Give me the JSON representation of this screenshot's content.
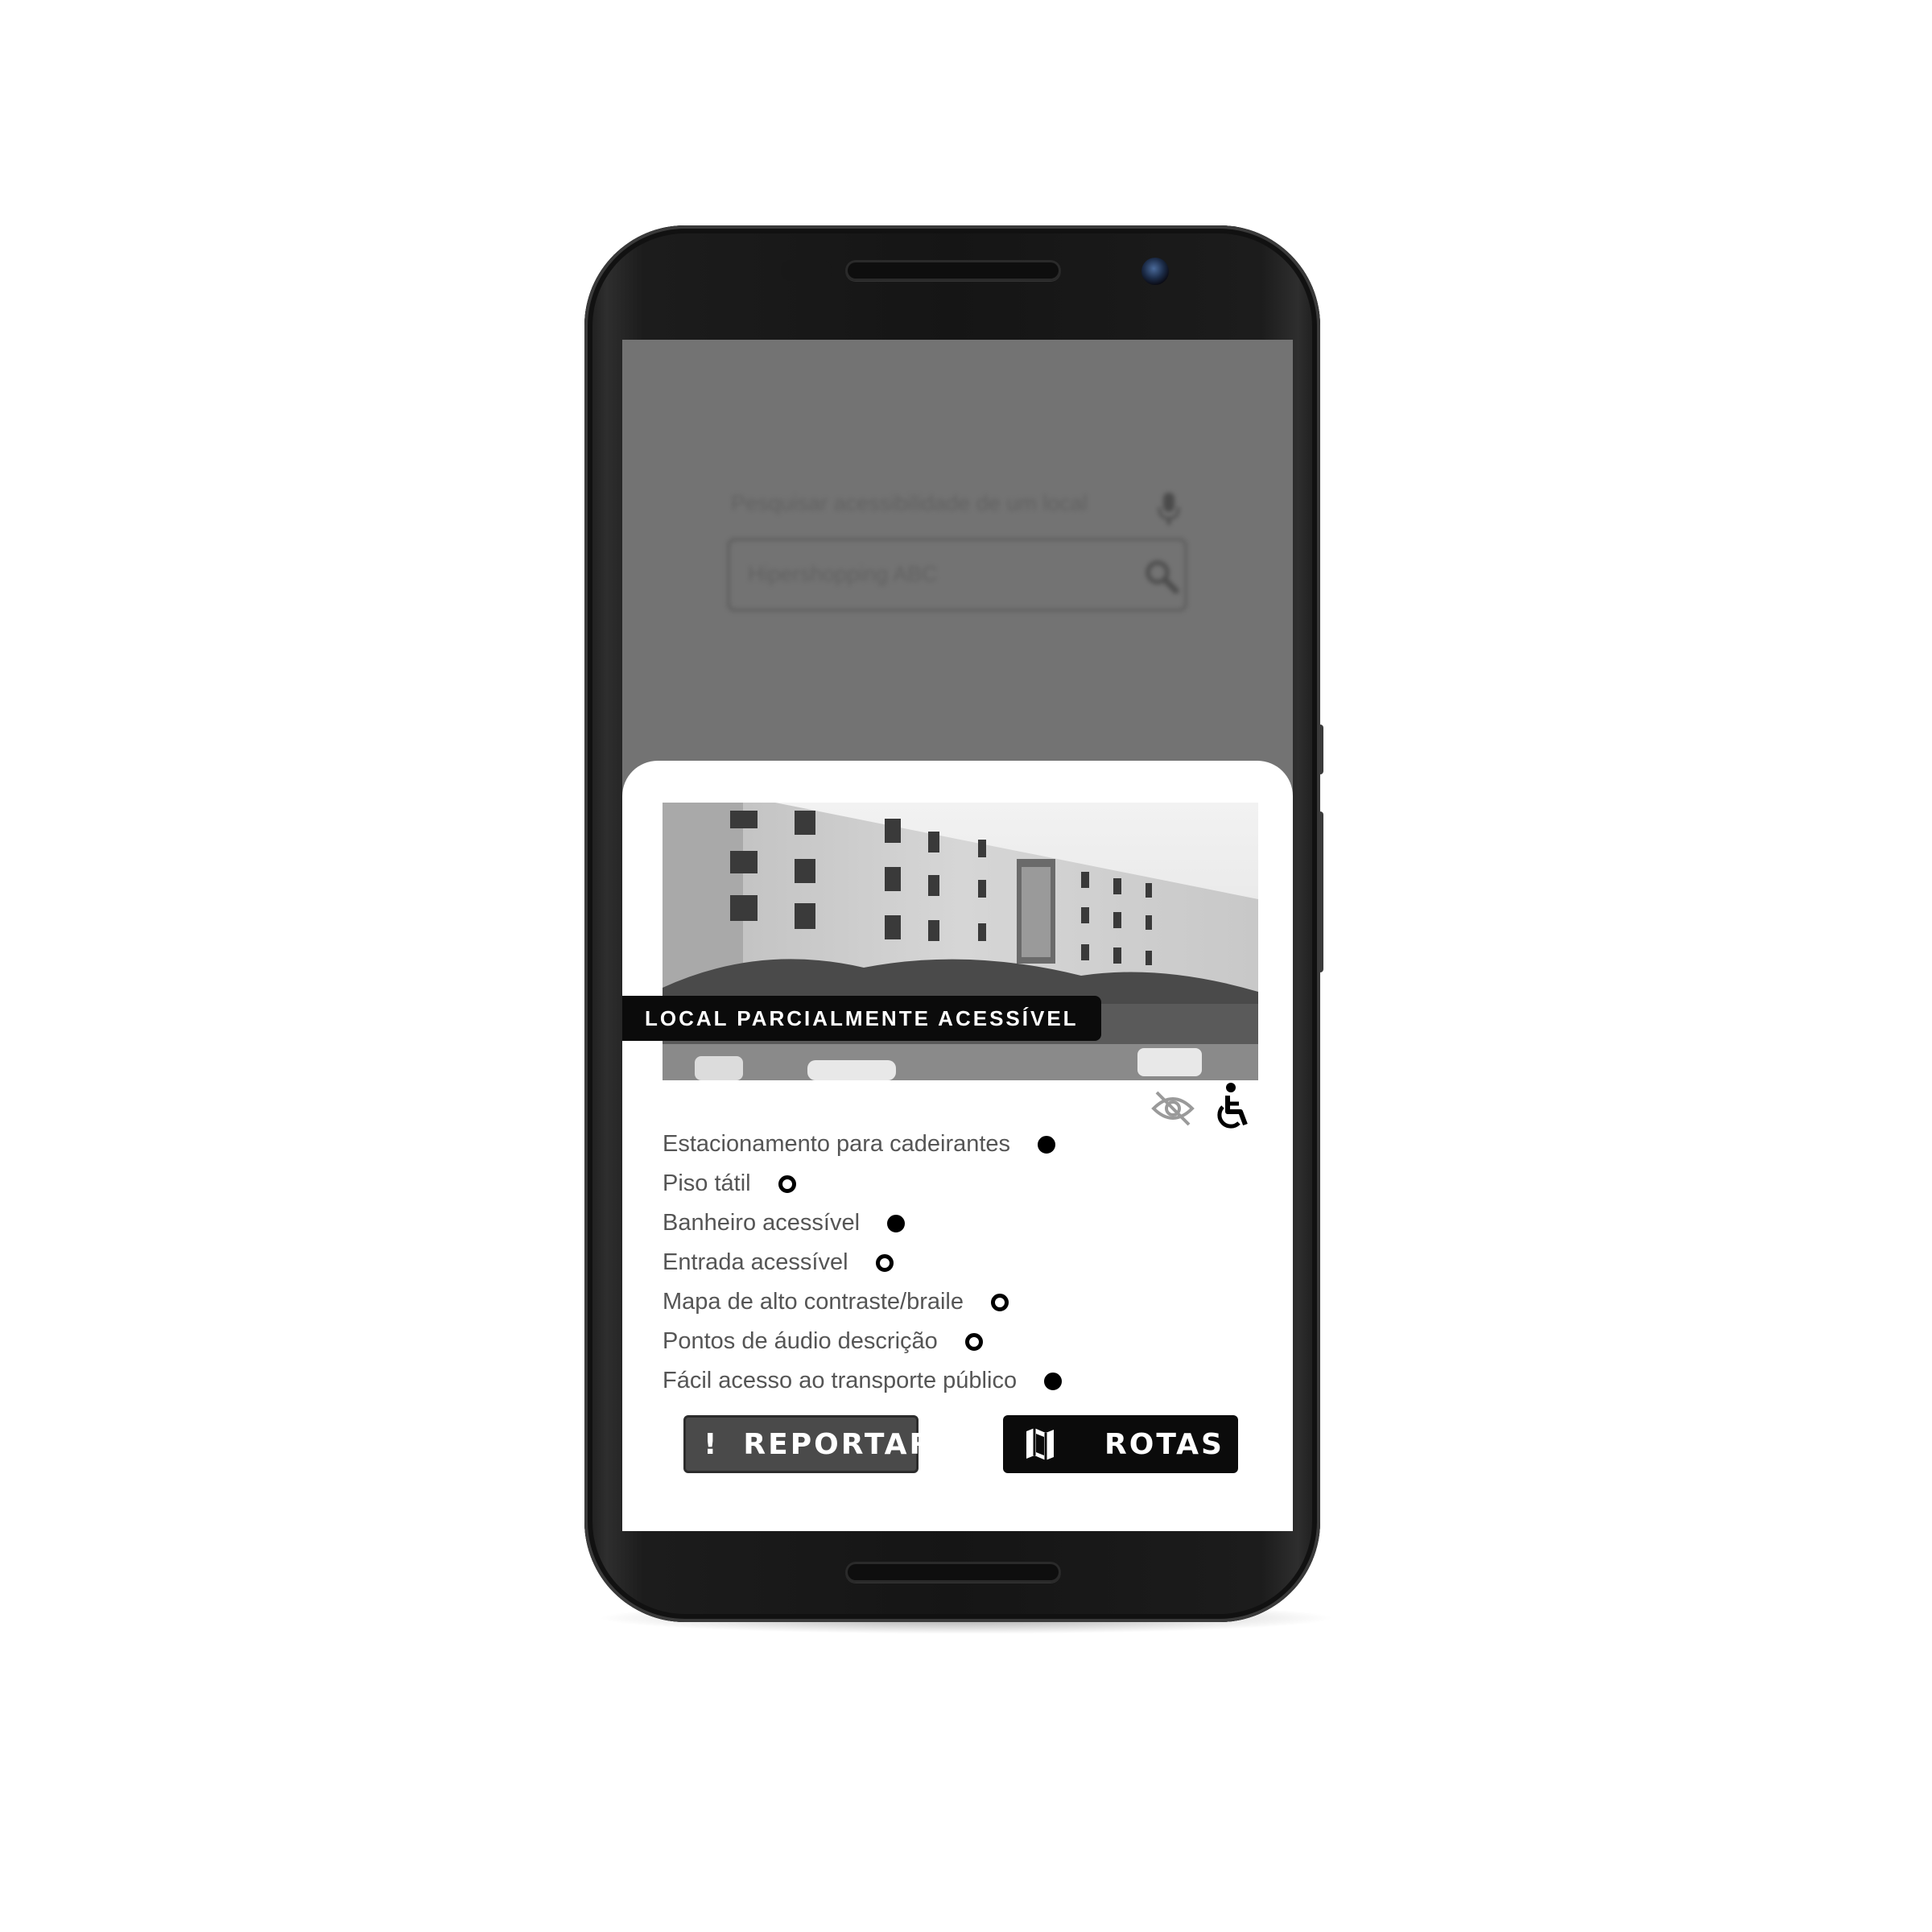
{
  "background_search": {
    "label": "Pesquisar acessibilidade de um local",
    "input_value": "Hipershopping ABC",
    "mic_icon": "microphone-icon",
    "search_icon": "search-icon"
  },
  "place_card": {
    "photo_icon": "building-photo",
    "badge": "LOCAL PARCIALMENTE ACESSÍVEL",
    "type_icons": [
      "visual-impairment-icon",
      "wheelchair-icon"
    ],
    "features": [
      {
        "label": "Estacionamento para cadeirantes",
        "available": true
      },
      {
        "label": "Piso tátil",
        "available": false
      },
      {
        "label": "Banheiro acessível",
        "available": true
      },
      {
        "label": "Entrada acessível",
        "available": false
      },
      {
        "label": "Mapa de alto contraste/braile",
        "available": false
      },
      {
        "label": "Pontos de áudio descrição",
        "available": false
      },
      {
        "label": "Fácil acesso ao transporte público",
        "available": true
      }
    ],
    "report_button": {
      "icon": "!",
      "label": "REPORTAR"
    },
    "routes_button": {
      "icon": "map-icon",
      "label": "ROTAS"
    }
  },
  "colors": {
    "screen_overlay": "#737373",
    "sheet": "#ffffff",
    "badge_bg": "#0b0b0b",
    "report_bg": "#4a4a4a",
    "routes_bg": "#0b0b0b"
  }
}
